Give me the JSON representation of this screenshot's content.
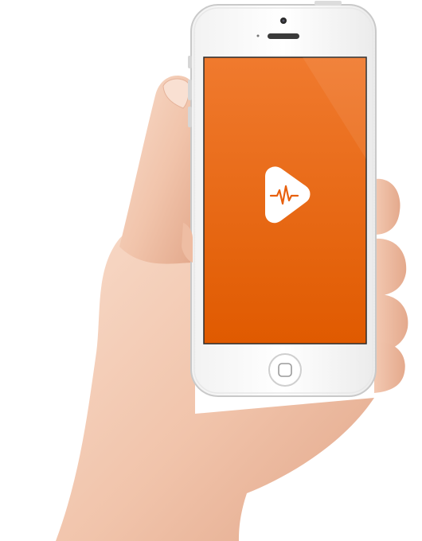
{
  "scene": {
    "subject": "hand-holding-phone",
    "phone": {
      "body_color": "#ffffff",
      "bezel_color": "#e8e8e8",
      "frame_color": "#c9c9c9"
    },
    "screen": {
      "background_top": "#f07a2e",
      "background_bottom": "#e05a00",
      "logo": {
        "icon": "pulse-play-logo-icon",
        "color": "#ffffff",
        "accent": "#e8600e"
      }
    },
    "hand": {
      "skin_light": "#f6d3bf",
      "skin_mid": "#efbfa5",
      "skin_shadow": "#d99a7d"
    }
  }
}
